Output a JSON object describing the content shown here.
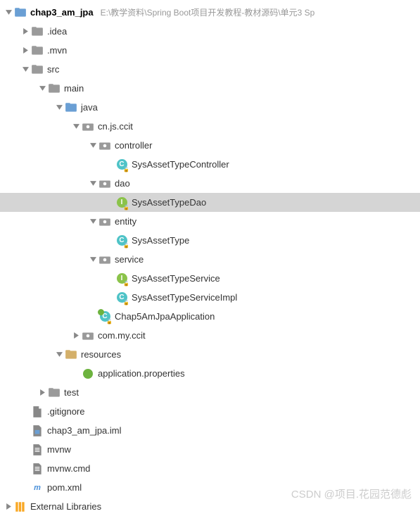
{
  "project": {
    "name": "chap3_am_jpa",
    "path": "E:\\教学资料\\Spring Boot项目开发教程-教材源码\\单元3  Sp"
  },
  "tree": {
    "idea": ".idea",
    "mvn": ".mvn",
    "src": "src",
    "main": "main",
    "java": "java",
    "pkg_root": "cn.js.ccit",
    "controller": "controller",
    "controller_class": "SysAssetTypeController",
    "dao": "dao",
    "dao_interface": "SysAssetTypeDao",
    "entity": "entity",
    "entity_class": "SysAssetType",
    "service": "service",
    "service_interface": "SysAssetTypeService",
    "service_impl": "SysAssetTypeServiceImpl",
    "app_class": "Chap5AmJpaApplication",
    "pkg_other": "com.my.ccit",
    "resources": "resources",
    "app_props": "application.properties",
    "test": "test",
    "gitignore": ".gitignore",
    "iml": "chap3_am_jpa.iml",
    "mvnw": "mvnw",
    "mvnw_cmd": "mvnw.cmd",
    "pom": "pom.xml",
    "ext_libs": "External Libraries"
  },
  "watermark": "CSDN @项目.花园范德彪"
}
